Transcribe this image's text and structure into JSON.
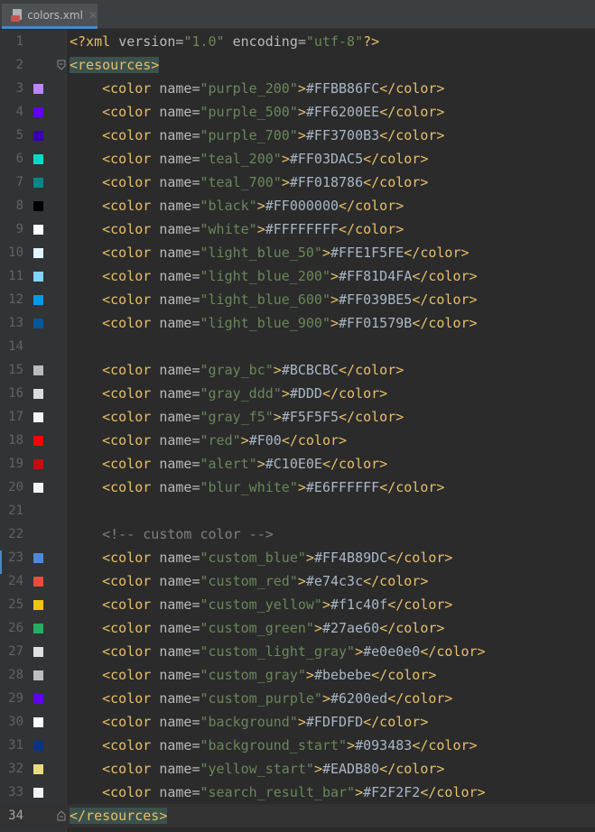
{
  "tab": {
    "title": "colors.xml",
    "close": "✕",
    "icon": "xml-file-icon"
  },
  "current_line": 34,
  "lines": [
    {
      "n": 1,
      "kind": "decl",
      "text": "<?xml version=\"1.0\" encoding=\"utf-8\"?>"
    },
    {
      "n": 2,
      "kind": "open",
      "tag": "resources"
    },
    {
      "n": 3,
      "kind": "color",
      "name": "purple_200",
      "value": "#FFBB86FC",
      "swatch": "#BB86FC"
    },
    {
      "n": 4,
      "kind": "color",
      "name": "purple_500",
      "value": "#FF6200EE",
      "swatch": "#6200EE"
    },
    {
      "n": 5,
      "kind": "color",
      "name": "purple_700",
      "value": "#FF3700B3",
      "swatch": "#3700B3"
    },
    {
      "n": 6,
      "kind": "color",
      "name": "teal_200",
      "value": "#FF03DAC5",
      "swatch": "#03DAC5"
    },
    {
      "n": 7,
      "kind": "color",
      "name": "teal_700",
      "value": "#FF018786",
      "swatch": "#018786"
    },
    {
      "n": 8,
      "kind": "color",
      "name": "black",
      "value": "#FF000000",
      "swatch": "#000000"
    },
    {
      "n": 9,
      "kind": "color",
      "name": "white",
      "value": "#FFFFFFFF",
      "swatch": "#FFFFFF"
    },
    {
      "n": 10,
      "kind": "color",
      "name": "light_blue_50",
      "value": "#FFE1F5FE",
      "swatch": "#E1F5FE"
    },
    {
      "n": 11,
      "kind": "color",
      "name": "light_blue_200",
      "value": "#FF81D4FA",
      "swatch": "#81D4FA"
    },
    {
      "n": 12,
      "kind": "color",
      "name": "light_blue_600",
      "value": "#FF039BE5",
      "swatch": "#039BE5"
    },
    {
      "n": 13,
      "kind": "color",
      "name": "light_blue_900",
      "value": "#FF01579B",
      "swatch": "#01579B"
    },
    {
      "n": 14,
      "kind": "blank"
    },
    {
      "n": 15,
      "kind": "color",
      "name": "gray_bc",
      "value": "#BCBCBC",
      "swatch": "#BCBCBC"
    },
    {
      "n": 16,
      "kind": "color",
      "name": "gray_ddd",
      "value": "#DDD",
      "swatch": "#DDDDDD"
    },
    {
      "n": 17,
      "kind": "color",
      "name": "gray_f5",
      "value": "#F5F5F5",
      "swatch": "#F5F5F5"
    },
    {
      "n": 18,
      "kind": "color",
      "name": "red",
      "value": "#F00",
      "swatch": "#FF0000"
    },
    {
      "n": 19,
      "kind": "color",
      "name": "alert",
      "value": "#C10E0E",
      "swatch": "#C10E0E"
    },
    {
      "n": 20,
      "kind": "color",
      "name": "blur_white",
      "value": "#E6FFFFFF",
      "swatch": "#F4F4F4"
    },
    {
      "n": 21,
      "kind": "blank"
    },
    {
      "n": 22,
      "kind": "comment",
      "text": "<!-- custom color -->"
    },
    {
      "n": 23,
      "kind": "color",
      "name": "custom_blue",
      "value": "#FF4B89DC",
      "swatch": "#4B89DC"
    },
    {
      "n": 24,
      "kind": "color",
      "name": "custom_red",
      "value": "#e74c3c",
      "swatch": "#E74C3C"
    },
    {
      "n": 25,
      "kind": "color",
      "name": "custom_yellow",
      "value": "#f1c40f",
      "swatch": "#F1C40F"
    },
    {
      "n": 26,
      "kind": "color",
      "name": "custom_green",
      "value": "#27ae60",
      "swatch": "#27AE60"
    },
    {
      "n": 27,
      "kind": "color",
      "name": "custom_light_gray",
      "value": "#e0e0e0",
      "swatch": "#E0E0E0"
    },
    {
      "n": 28,
      "kind": "color",
      "name": "custom_gray",
      "value": "#bebebe",
      "swatch": "#BEBEBE"
    },
    {
      "n": 29,
      "kind": "color",
      "name": "custom_purple",
      "value": "#6200ed",
      "swatch": "#6200ED"
    },
    {
      "n": 30,
      "kind": "color",
      "name": "background",
      "value": "#FDFDFD",
      "swatch": "#FDFDFD"
    },
    {
      "n": 31,
      "kind": "color",
      "name": "background_start",
      "value": "#093483",
      "swatch": "#093483"
    },
    {
      "n": 32,
      "kind": "color",
      "name": "yellow_start",
      "value": "#EADB80",
      "swatch": "#EADB80"
    },
    {
      "n": 33,
      "kind": "color",
      "name": "search_result_bar",
      "value": "#F2F2F2",
      "swatch": "#F2F2F2"
    },
    {
      "n": 34,
      "kind": "close",
      "tag": "resources"
    }
  ]
}
